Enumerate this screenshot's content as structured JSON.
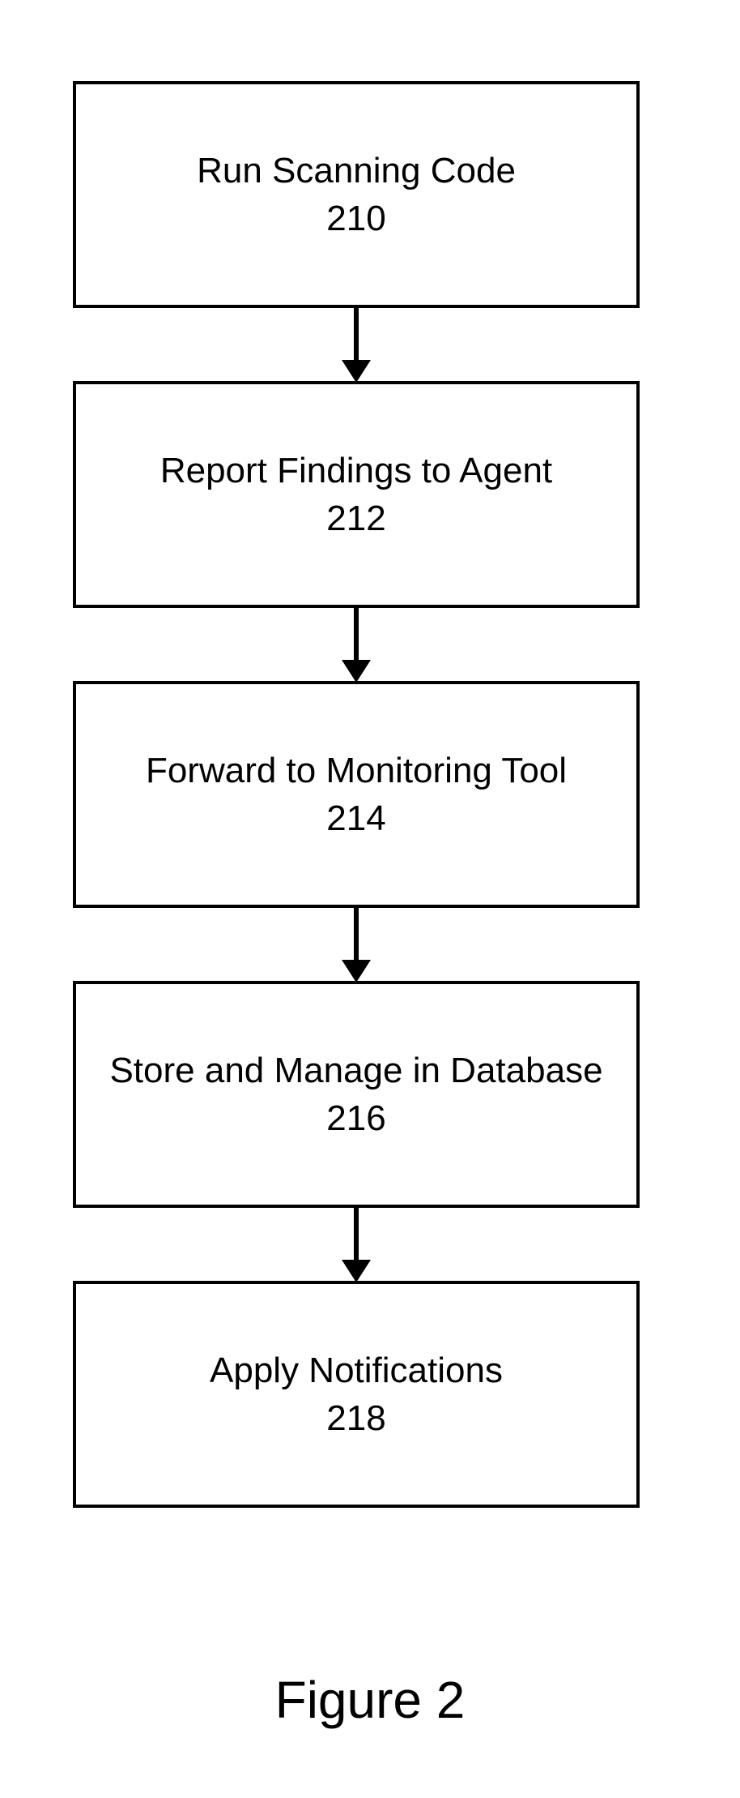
{
  "flow": {
    "steps": [
      {
        "label": "Run Scanning Code",
        "num": "210"
      },
      {
        "label": "Report Findings to Agent",
        "num": "212"
      },
      {
        "label": "Forward to Monitoring Tool",
        "num": "214"
      },
      {
        "label": "Store and Manage in Database",
        "num": "216"
      },
      {
        "label": "Apply Notifications",
        "num": "218"
      }
    ]
  },
  "caption": "Figure 2"
}
